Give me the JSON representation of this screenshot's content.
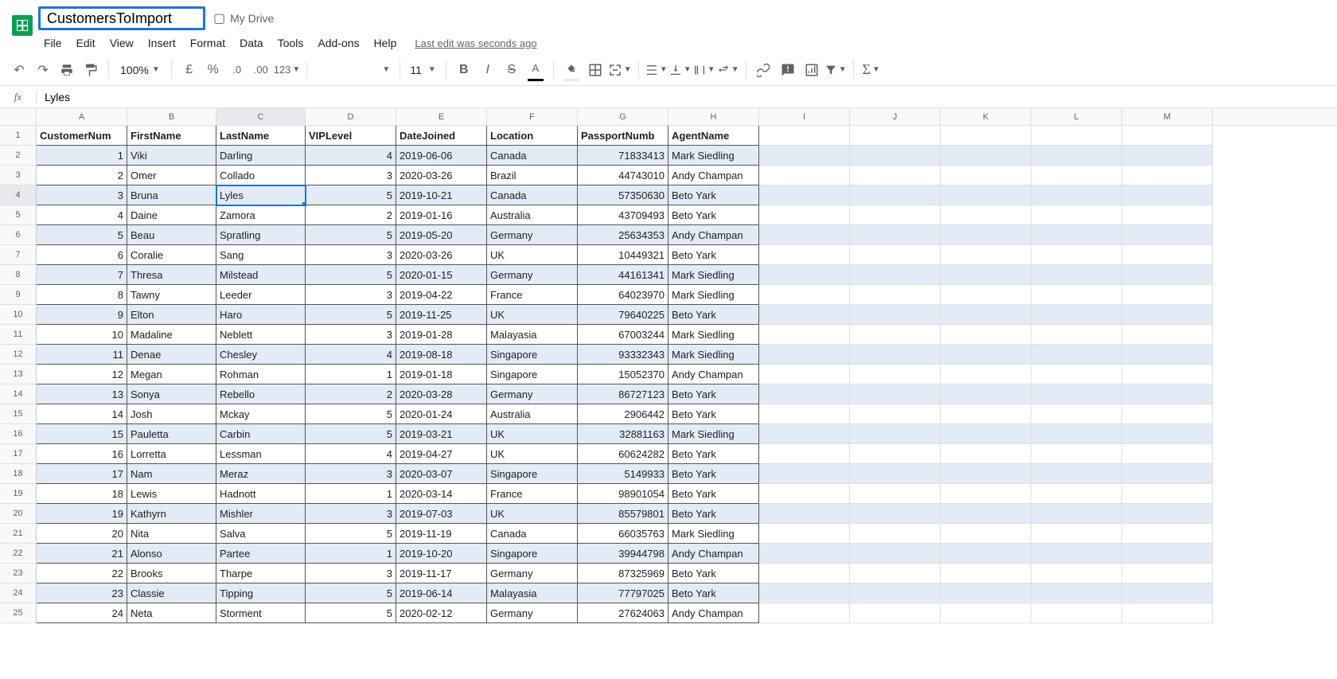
{
  "doc_title": "CustomersToImport",
  "drive_location": "My Drive",
  "menus": [
    "File",
    "Edit",
    "View",
    "Insert",
    "Format",
    "Data",
    "Tools",
    "Add-ons",
    "Help"
  ],
  "last_edit": "Last edit was seconds ago",
  "zoom": "100%",
  "font_size": "11",
  "formula_value": "Lyles",
  "col_letters": [
    "A",
    "B",
    "C",
    "D",
    "E",
    "F",
    "G",
    "H",
    "I",
    "J",
    "K",
    "L",
    "M"
  ],
  "headers": [
    "CustomerNum",
    "FirstName",
    "LastName",
    "VIPLevel",
    "DateJoined",
    "Location",
    "PassportNumb",
    "AgentName"
  ],
  "rows": [
    {
      "n": "1",
      "fn": "Viki",
      "ln": "Darling",
      "v": "4",
      "d": "2019-06-06",
      "loc": "Canada",
      "p": "71833413",
      "a": "Mark Siedling"
    },
    {
      "n": "2",
      "fn": "Omer",
      "ln": "Collado",
      "v": "3",
      "d": "2020-03-26",
      "loc": "Brazil",
      "p": "44743010",
      "a": "Andy Champan"
    },
    {
      "n": "3",
      "fn": "Bruna",
      "ln": "Lyles",
      "v": "5",
      "d": "2019-10-21",
      "loc": "Canada",
      "p": "57350630",
      "a": "Beto Yark"
    },
    {
      "n": "4",
      "fn": "Daine",
      "ln": "Zamora",
      "v": "2",
      "d": "2019-01-16",
      "loc": "Australia",
      "p": "43709493",
      "a": "Beto Yark"
    },
    {
      "n": "5",
      "fn": "Beau",
      "ln": "Spratling",
      "v": "5",
      "d": "2019-05-20",
      "loc": "Germany",
      "p": "25634353",
      "a": "Andy Champan"
    },
    {
      "n": "6",
      "fn": "Coralie",
      "ln": "Sang",
      "v": "3",
      "d": "2020-03-26",
      "loc": "UK",
      "p": "10449321",
      "a": "Beto Yark"
    },
    {
      "n": "7",
      "fn": "Thresa",
      "ln": "Milstead",
      "v": "5",
      "d": "2020-01-15",
      "loc": "Germany",
      "p": "44161341",
      "a": "Mark Siedling"
    },
    {
      "n": "8",
      "fn": "Tawny",
      "ln": "Leeder",
      "v": "3",
      "d": "2019-04-22",
      "loc": "France",
      "p": "64023970",
      "a": "Mark Siedling"
    },
    {
      "n": "9",
      "fn": "Elton",
      "ln": "Haro",
      "v": "5",
      "d": "2019-11-25",
      "loc": "UK",
      "p": "79640225",
      "a": "Beto Yark"
    },
    {
      "n": "10",
      "fn": "Madaline",
      "ln": "Neblett",
      "v": "3",
      "d": "2019-01-28",
      "loc": "Malayasia",
      "p": "67003244",
      "a": "Mark Siedling"
    },
    {
      "n": "11",
      "fn": "Denae",
      "ln": "Chesley",
      "v": "4",
      "d": "2019-08-18",
      "loc": "Singapore",
      "p": "93332343",
      "a": "Mark Siedling"
    },
    {
      "n": "12",
      "fn": "Megan",
      "ln": "Rohman",
      "v": "1",
      "d": "2019-01-18",
      "loc": "Singapore",
      "p": "15052370",
      "a": "Andy Champan"
    },
    {
      "n": "13",
      "fn": "Sonya",
      "ln": "Rebello",
      "v": "2",
      "d": "2020-03-28",
      "loc": "Germany",
      "p": "86727123",
      "a": "Beto Yark"
    },
    {
      "n": "14",
      "fn": "Josh",
      "ln": "Mckay",
      "v": "5",
      "d": "2020-01-24",
      "loc": "Australia",
      "p": "2906442",
      "a": "Beto Yark"
    },
    {
      "n": "15",
      "fn": "Pauletta",
      "ln": "Carbin",
      "v": "5",
      "d": "2019-03-21",
      "loc": "UK",
      "p": "32881163",
      "a": "Mark Siedling"
    },
    {
      "n": "16",
      "fn": "Lorretta",
      "ln": "Lessman",
      "v": "4",
      "d": "2019-04-27",
      "loc": "UK",
      "p": "60624282",
      "a": "Beto Yark"
    },
    {
      "n": "17",
      "fn": "Nam",
      "ln": "Meraz",
      "v": "3",
      "d": "2020-03-07",
      "loc": "Singapore",
      "p": "5149933",
      "a": "Beto Yark"
    },
    {
      "n": "18",
      "fn": "Lewis",
      "ln": "Hadnott",
      "v": "1",
      "d": "2020-03-14",
      "loc": "France",
      "p": "98901054",
      "a": "Beto Yark"
    },
    {
      "n": "19",
      "fn": "Kathyrn",
      "ln": "Mishler",
      "v": "3",
      "d": "2019-07-03",
      "loc": "UK",
      "p": "85579801",
      "a": "Beto Yark"
    },
    {
      "n": "20",
      "fn": "Nita",
      "ln": "Salva",
      "v": "5",
      "d": "2019-11-19",
      "loc": "Canada",
      "p": "66035763",
      "a": "Mark Siedling"
    },
    {
      "n": "21",
      "fn": "Alonso",
      "ln": "Partee",
      "v": "1",
      "d": "2019-10-20",
      "loc": "Singapore",
      "p": "39944798",
      "a": "Andy Champan"
    },
    {
      "n": "22",
      "fn": "Brooks",
      "ln": "Tharpe",
      "v": "3",
      "d": "2019-11-17",
      "loc": "Germany",
      "p": "87325969",
      "a": "Beto Yark"
    },
    {
      "n": "23",
      "fn": "Classie",
      "ln": "Tipping",
      "v": "5",
      "d": "2019-06-14",
      "loc": "Malayasia",
      "p": "77797025",
      "a": "Beto Yark"
    },
    {
      "n": "24",
      "fn": "Neta",
      "ln": "Storment",
      "v": "5",
      "d": "2020-02-12",
      "loc": "Germany",
      "p": "27624063",
      "a": "Andy Champan"
    }
  ],
  "selected": {
    "row": 4,
    "col": "C"
  }
}
